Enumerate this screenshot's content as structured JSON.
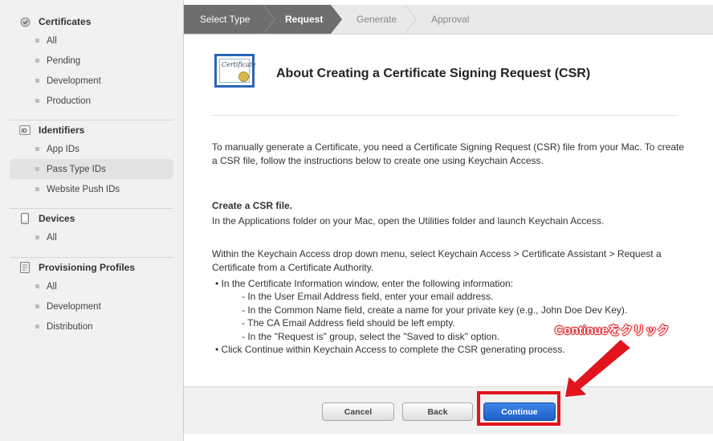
{
  "sidebar": {
    "sections": [
      {
        "title": "Certificates",
        "icon": "certificate-icon",
        "items": [
          "All",
          "Pending",
          "Development",
          "Production"
        ]
      },
      {
        "title": "Identifiers",
        "icon": "id-icon",
        "items": [
          "App IDs",
          "Pass Type IDs",
          "Website Push IDs"
        ],
        "active_item": "Pass Type IDs"
      },
      {
        "title": "Devices",
        "icon": "device-icon",
        "items": [
          "All"
        ]
      },
      {
        "title": "Provisioning Profiles",
        "icon": "profile-icon",
        "items": [
          "All",
          "Development",
          "Distribution"
        ]
      }
    ]
  },
  "steps": {
    "items": [
      "Select Type",
      "Request",
      "Generate",
      "Approval"
    ],
    "active": "Request"
  },
  "main": {
    "title": "About Creating a Certificate Signing Request (CSR)",
    "icon_text": "Certificate",
    "intro": "To manually generate a Certificate, you need a Certificate Signing Request (CSR) file from your Mac. To create a CSR file, follow the instructions below to create one using Keychain Access.",
    "heading": "Create a CSR file.",
    "step1": "In the Applications folder on your Mac, open the Utilities folder and launch Keychain Access.",
    "step2": "Within the Keychain Access drop down menu, select Keychain Access > Certificate Assistant > Request a Certificate from a Certificate Authority.",
    "bullet1": "In the Certificate Information window, enter the following information:",
    "sub1": "- In the User Email Address field, enter your email address.",
    "sub2": "- In the Common Name field, create a name for your private key (e.g., John Doe Dev Key).",
    "sub3": "- The CA Email Address field should be left empty.",
    "sub4": "- In the \"Request is\" group, select the \"Saved to disk\" option.",
    "bullet2": "Click Continue within Keychain Access to complete the CSR generating process."
  },
  "footer": {
    "cancel": "Cancel",
    "back": "Back",
    "continue": "Continue"
  },
  "annotation": {
    "callout": "Continueをクリック",
    "color": "#e1151b"
  }
}
